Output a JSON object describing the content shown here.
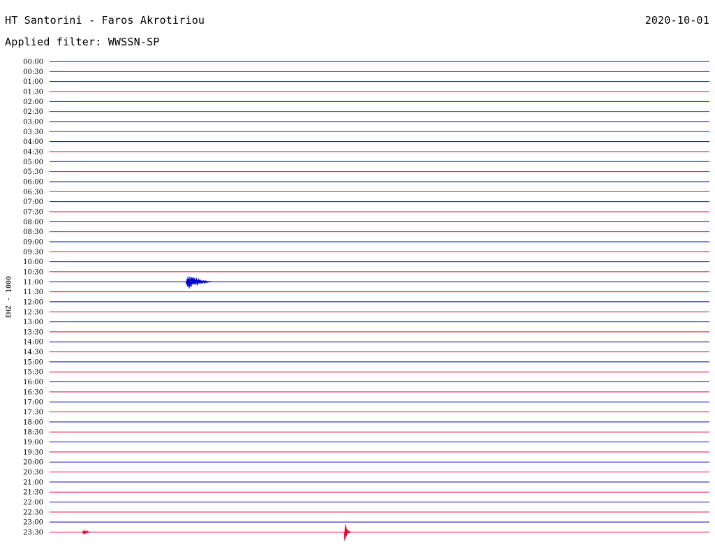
{
  "header": {
    "station": "HT Santorini - Faros Akrotiriou",
    "date": "2020-10-01",
    "filter": "Applied filter: WWSSN-SP"
  },
  "channel_label": "EHZ - 1000",
  "colors": {
    "blue_trace": "#0000cc",
    "red_trace": "#e8003a"
  },
  "chart_data": {
    "type": "line",
    "title": "HT Santorini - Faros Akrotiriou",
    "ylabel": "EHZ - 1000",
    "tick_labels": [
      "00:00",
      "00:30",
      "01:00",
      "01:30",
      "02:00",
      "02:30",
      "03:00",
      "03:30",
      "04:00",
      "04:30",
      "05:00",
      "05:30",
      "06:00",
      "06:30",
      "07:00",
      "07:30",
      "08:00",
      "08:30",
      "09:00",
      "09:30",
      "10:00",
      "10:30",
      "11:00",
      "11:30",
      "12:00",
      "12:30",
      "13:00",
      "13:30",
      "14:00",
      "14:30",
      "15:00",
      "15:30",
      "16:00",
      "16:30",
      "17:00",
      "17:30",
      "18:00",
      "18:30",
      "19:00",
      "19:30",
      "20:00",
      "20:30",
      "21:00",
      "21:30",
      "22:00",
      "22:30",
      "23:00",
      "23:30"
    ],
    "x_range_minutes": [
      0,
      30
    ],
    "series": [
      {
        "color": "blue",
        "rows": "on the hour"
      },
      {
        "color": "red",
        "rows": "on the half hour"
      }
    ],
    "events": [
      {
        "row": "11:00",
        "start_min": 6.2,
        "end_min": 7.4,
        "amplitude": 0.9
      },
      {
        "row": "23:30",
        "start_min": 1.5,
        "end_min": 1.9,
        "amplitude": 0.3
      },
      {
        "row": "23:30",
        "start_min": 13.4,
        "end_min": 13.7,
        "amplitude": 1.0
      }
    ]
  }
}
